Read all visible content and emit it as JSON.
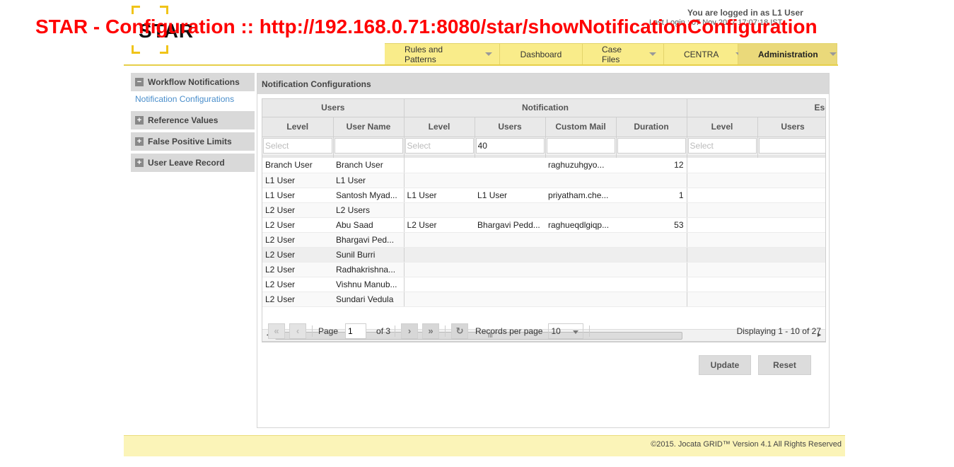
{
  "overlay_title": "STAR - Configuration :: http://192.168.0.71:8080/star/showNotificationConfiguration",
  "logo": {
    "text": "STAR"
  },
  "header": {
    "logged_in": "You are logged in as L1 User",
    "last_login": "Last Login : 07 Nov 2017 17:07:18 IST"
  },
  "nav": {
    "tabs": [
      {
        "label": "Rules and Patterns",
        "dropdown": true
      },
      {
        "label": "Dashboard",
        "dropdown": false
      },
      {
        "label": "Case Files",
        "dropdown": true
      },
      {
        "label": "CENTRA",
        "dropdown": true
      },
      {
        "label": "Administration",
        "dropdown": true,
        "active": true
      }
    ]
  },
  "sidebar": {
    "sections": [
      {
        "label": "Workflow Notifications",
        "expanded": true,
        "sub": "Notification Configurations"
      },
      {
        "label": "Reference Values",
        "expanded": false
      },
      {
        "label": "False Positive Limits",
        "expanded": false
      },
      {
        "label": "User Leave Record",
        "expanded": false
      }
    ]
  },
  "panel": {
    "title": "Notification Configurations"
  },
  "grid": {
    "groups": [
      "Users",
      "Notification",
      "Esca"
    ],
    "columns": [
      "Level",
      "User Name",
      "Level",
      "Users",
      "Custom Mail",
      "Duration",
      "Level",
      "Users"
    ],
    "filters": {
      "placeholder": "Select",
      "notif_users_value": "40"
    },
    "rows": [
      [
        "Branch User",
        "Branch User",
        "",
        "",
        "raghuzuhgyo...",
        "12",
        "",
        ""
      ],
      [
        "L1 User",
        "L1 User",
        "",
        "",
        "",
        "",
        "",
        ""
      ],
      [
        "L1 User",
        "Santosh Myad...",
        "L1 User",
        "L1 User",
        "priyatham.che...",
        "1",
        "",
        ""
      ],
      [
        "L2 User",
        "L2 Users",
        "",
        "",
        "",
        "",
        "",
        ""
      ],
      [
        "L2 User",
        "Abu Saad",
        "L2 User",
        "Bhargavi Pedd...",
        "raghueqdlgiqp...",
        "53",
        "",
        ""
      ],
      [
        "L2 User",
        "Bhargavi Ped...",
        "",
        "",
        "",
        "",
        "",
        ""
      ],
      [
        "L2 User",
        "Sunil Burri",
        "",
        "",
        "",
        "",
        "",
        ""
      ],
      [
        "L2 User",
        "Radhakrishna...",
        "",
        "",
        "",
        "",
        "",
        ""
      ],
      [
        "L2 User",
        "Vishnu Manub...",
        "",
        "",
        "",
        "",
        "",
        ""
      ],
      [
        "L2 User",
        "Sundari Vedula",
        "",
        "",
        "",
        "",
        "",
        ""
      ]
    ]
  },
  "pager": {
    "page_label": "Page",
    "page_value": "1",
    "of_label": "of 3",
    "records_label": "Records per page",
    "records_value": "10",
    "display": "Displaying 1 - 10 of 27"
  },
  "buttons": {
    "update": "Update",
    "reset": "Reset"
  },
  "footer": {
    "text": "©2015. Jocata GRID™ Version 4.1 All Rights Reserved"
  }
}
